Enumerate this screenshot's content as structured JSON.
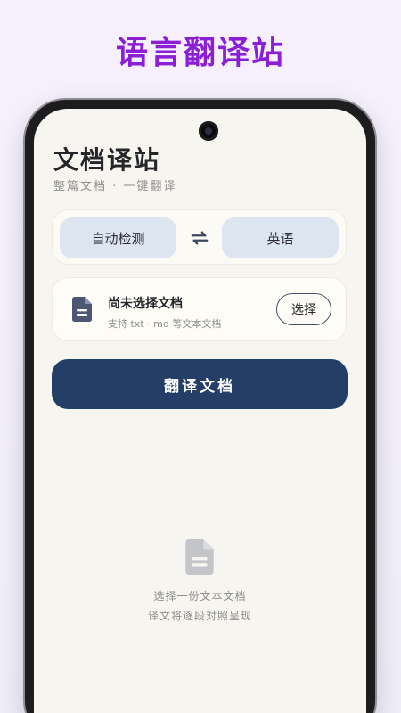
{
  "promo": {
    "title": "语言翻译站"
  },
  "app": {
    "title": "文档译站",
    "subtitle": "整篇文档 · 一键翻译"
  },
  "language_selector": {
    "source": "自动检测",
    "target": "英语",
    "swap_icon": "swap-arrows-icon"
  },
  "file_picker": {
    "icon": "document-icon",
    "status": "尚未选择文档",
    "hint": "支持 txt · md 等文本文档",
    "choose_label": "选择"
  },
  "actions": {
    "translate_label": "翻译文档"
  },
  "empty_state": {
    "icon": "document-icon",
    "line1": "选择一份文本文档",
    "line2": "译文将逐段对照呈现"
  },
  "colors": {
    "promo_title": "#8a1fd6",
    "primary": "#253e68",
    "chip_bg": "#dde5f1",
    "screen_bg": "#f7f5ef"
  }
}
